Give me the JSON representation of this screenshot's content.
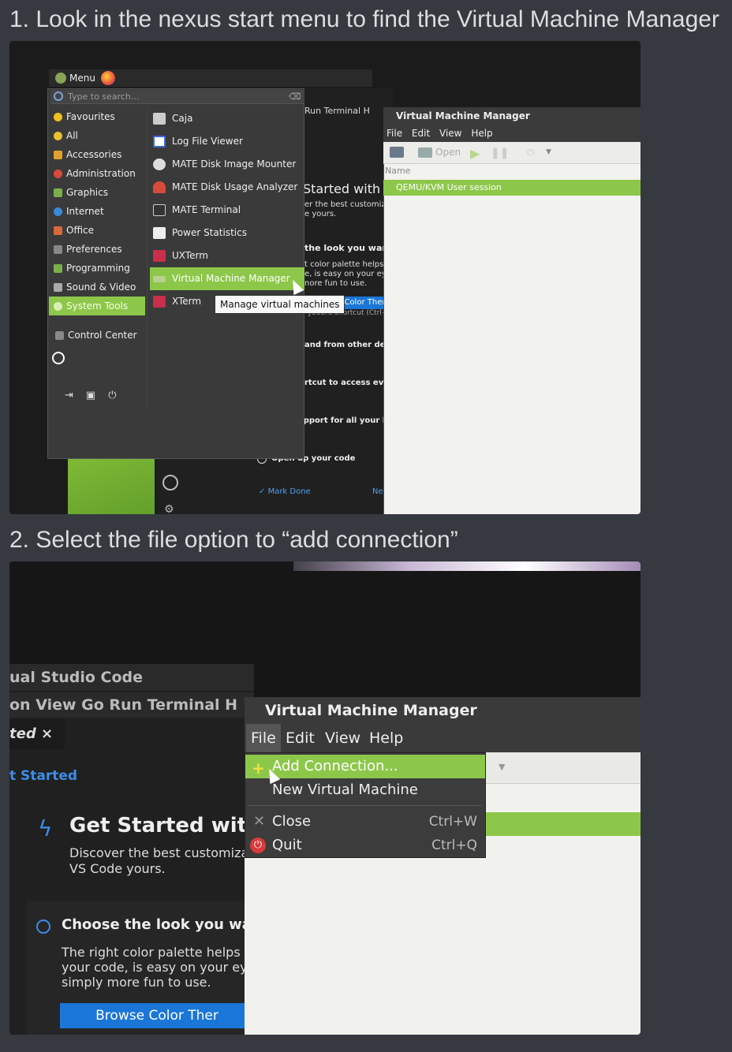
{
  "step1": {
    "title": "1. Look in the nexus start menu to find the Virtual Machine Manager",
    "menu_label": "Menu",
    "search_placeholder": "Type to search...",
    "categories": [
      "Favourites",
      "All",
      "Accessories",
      "Administration",
      "Graphics",
      "Internet",
      "Office",
      "Preferences",
      "Programming",
      "Sound & Video",
      "System Tools"
    ],
    "active_category": "System Tools",
    "control_center": "Control Center",
    "apps": [
      "Caja",
      "Log File Viewer",
      "MATE Disk Image Mounter",
      "MATE Disk Usage Analyzer",
      "MATE Terminal",
      "Power Statistics",
      "UXTerm",
      "Virtual Machine Manager",
      "XTerm"
    ],
    "active_app": "Virtual Machine Manager",
    "tooltip": "Manage virtual machines",
    "vscode": {
      "menu": "Run  Terminal  H",
      "heading": "Started with V",
      "subtext": [
        "er the best customiza",
        "e yours."
      ],
      "look": "the look you want",
      "look_desc": [
        "t color palette helps y",
        "e, is easy on your eye",
        "nore fun to use."
      ],
      "browse": "vse Color Ther",
      "shortcut": "yboard shortcut (Ctrl+K (",
      "other_devices": "and from other devi",
      "shortcut_access": "rtcut to access ever",
      "rich_support": "Rich support for all your lan",
      "open_code": "Open up your code",
      "mark_done": "Mark Done",
      "next": "Ne"
    },
    "vmm": {
      "title": "Virtual Machine Manager",
      "menu": [
        "File",
        "Edit",
        "View",
        "Help"
      ],
      "open_label": "Open",
      "column_name": "Name",
      "session": "QEMU/KVM User session"
    }
  },
  "step2": {
    "title": "2. Select the file option to “add connection”",
    "vscode": {
      "title": "ual Studio Code",
      "menu": "on  View  Go  Run  Terminal  H",
      "tab": "ted",
      "tab_close": "×",
      "started": "t Started",
      "heading": "Get Started with V",
      "subtext": [
        "Discover the best customiza",
        "VS Code yours."
      ],
      "look": "Choose the look you want",
      "look_desc": [
        "The right color palette helps y",
        "your code, is easy on your eye",
        "simply more fun to use."
      ],
      "browse": "Browse Color Ther"
    },
    "vmm": {
      "title": "Virtual Machine Manager",
      "menu": [
        "File",
        "Edit",
        "View",
        "Help"
      ],
      "file_menu": [
        {
          "label": "Add Connection...",
          "accel": ""
        },
        {
          "label": "New Virtual Machine",
          "accel": ""
        },
        {
          "label": "Close",
          "accel": "Ctrl+W"
        },
        {
          "label": "Quit",
          "accel": "Ctrl+Q"
        }
      ]
    }
  },
  "colors": {
    "background": "#36393f",
    "mint_green": "#8dc74a",
    "vscode_blue": "#1a76d7"
  },
  "icons": [
    "firefox-icon",
    "search-icon",
    "star-icon",
    "power-icon",
    "logout-icon",
    "lock-icon",
    "computer-icon",
    "play-icon",
    "pause-icon",
    "add-icon",
    "close-icon",
    "quit-icon",
    "mouse-cursor-icon"
  ]
}
